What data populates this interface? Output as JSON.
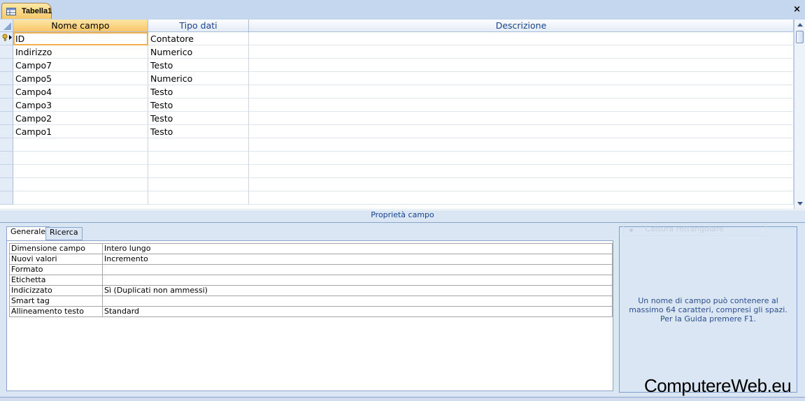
{
  "document_tab": {
    "title": "Tabella1",
    "icon": "table-icon"
  },
  "close_label": "×",
  "grid": {
    "columns": [
      "Nome campo",
      "Tipo dati",
      "Descrizione"
    ],
    "rows": [
      {
        "name": "ID",
        "type": "Contatore",
        "description": "",
        "primary_key": true
      },
      {
        "name": "Indirizzo",
        "type": "Numerico",
        "description": ""
      },
      {
        "name": "Campo7",
        "type": "Testo",
        "description": ""
      },
      {
        "name": "Campo5",
        "type": "Numerico",
        "description": ""
      },
      {
        "name": "Campo4",
        "type": "Testo",
        "description": ""
      },
      {
        "name": "Campo3",
        "type": "Testo",
        "description": ""
      },
      {
        "name": "Campo2",
        "type": "Testo",
        "description": ""
      },
      {
        "name": "Campo1",
        "type": "Testo",
        "description": ""
      },
      {
        "name": "",
        "type": "",
        "description": ""
      },
      {
        "name": "",
        "type": "",
        "description": ""
      },
      {
        "name": "",
        "type": "",
        "description": ""
      },
      {
        "name": "",
        "type": "",
        "description": ""
      },
      {
        "name": "",
        "type": "",
        "description": ""
      }
    ]
  },
  "properties": {
    "header": "Proprietà campo",
    "tabs": [
      "Generale",
      "Ricerca"
    ],
    "rows": [
      {
        "label": "Dimensione campo",
        "value": "Intero lungo"
      },
      {
        "label": "Nuovi valori",
        "value": "Incremento"
      },
      {
        "label": "Formato",
        "value": ""
      },
      {
        "label": "Etichetta",
        "value": ""
      },
      {
        "label": "Indicizzato",
        "value": "Sì (Duplicati non ammessi)"
      },
      {
        "label": "Smart tag",
        "value": ""
      },
      {
        "label": "Allineamento testo",
        "value": "Standard"
      }
    ]
  },
  "help": {
    "ghost_label": "Cattura rettangolare",
    "text": "Un nome di campo può contenere al massimo 64 caratteri, compresi gli spazi. Per la Guida premere F1."
  },
  "watermark": "ComputereWeb.eu",
  "colors": {
    "accent": "#f6c869",
    "header_text": "#15428b",
    "border": "#8ba6cb"
  }
}
